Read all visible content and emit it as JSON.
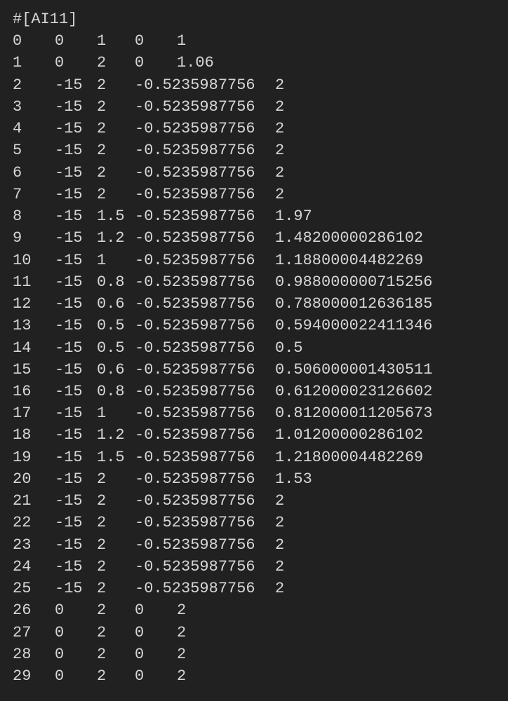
{
  "header": "#[AI11]",
  "rows": [
    {
      "c1": "0",
      "c2": "0",
      "c3": "1",
      "c4": "0",
      "c5": "1",
      "short4": true
    },
    {
      "c1": "1",
      "c2": "0",
      "c3": "2",
      "c4": "0",
      "c5": "1.06",
      "short4": true
    },
    {
      "c1": "2",
      "c2": "-15",
      "c3": "2",
      "c4": "-0.5235987756",
      "c5": "2",
      "short4": false
    },
    {
      "c1": "3",
      "c2": "-15",
      "c3": "2",
      "c4": "-0.5235987756",
      "c5": "2",
      "short4": false
    },
    {
      "c1": "4",
      "c2": "-15",
      "c3": "2",
      "c4": "-0.5235987756",
      "c5": "2",
      "short4": false
    },
    {
      "c1": "5",
      "c2": "-15",
      "c3": "2",
      "c4": "-0.5235987756",
      "c5": "2",
      "short4": false
    },
    {
      "c1": "6",
      "c2": "-15",
      "c3": "2",
      "c4": "-0.5235987756",
      "c5": "2",
      "short4": false
    },
    {
      "c1": "7",
      "c2": "-15",
      "c3": "2",
      "c4": "-0.5235987756",
      "c5": "2",
      "short4": false
    },
    {
      "c1": "8",
      "c2": "-15",
      "c3": "1.5",
      "c4": "-0.5235987756",
      "c5": "1.97",
      "short4": false
    },
    {
      "c1": "9",
      "c2": "-15",
      "c3": "1.2",
      "c4": "-0.5235987756",
      "c5": "1.48200000286102",
      "short4": false
    },
    {
      "c1": "10",
      "c2": "-15",
      "c3": "1",
      "c4": "-0.5235987756",
      "c5": "1.18800004482269",
      "short4": false
    },
    {
      "c1": "11",
      "c2": "-15",
      "c3": "0.8",
      "c4": "-0.5235987756",
      "c5": "0.988000000715256",
      "short4": false
    },
    {
      "c1": "12",
      "c2": "-15",
      "c3": "0.6",
      "c4": "-0.5235987756",
      "c5": "0.788000012636185",
      "short4": false
    },
    {
      "c1": "13",
      "c2": "-15",
      "c3": "0.5",
      "c4": "-0.5235987756",
      "c5": "0.594000022411346",
      "short4": false
    },
    {
      "c1": "14",
      "c2": "-15",
      "c3": "0.5",
      "c4": "-0.5235987756",
      "c5": "0.5",
      "short4": false
    },
    {
      "c1": "15",
      "c2": "-15",
      "c3": "0.6",
      "c4": "-0.5235987756",
      "c5": "0.506000001430511",
      "short4": false
    },
    {
      "c1": "16",
      "c2": "-15",
      "c3": "0.8",
      "c4": "-0.5235987756",
      "c5": "0.612000023126602",
      "short4": false
    },
    {
      "c1": "17",
      "c2": "-15",
      "c3": "1",
      "c4": "-0.5235987756",
      "c5": "0.812000011205673",
      "short4": false
    },
    {
      "c1": "18",
      "c2": "-15",
      "c3": "1.2",
      "c4": "-0.5235987756",
      "c5": "1.01200000286102",
      "short4": false
    },
    {
      "c1": "19",
      "c2": "-15",
      "c3": "1.5",
      "c4": "-0.5235987756",
      "c5": "1.21800004482269",
      "short4": false
    },
    {
      "c1": "20",
      "c2": "-15",
      "c3": "2",
      "c4": "-0.5235987756",
      "c5": "1.53",
      "short4": false
    },
    {
      "c1": "21",
      "c2": "-15",
      "c3": "2",
      "c4": "-0.5235987756",
      "c5": "2",
      "short4": false
    },
    {
      "c1": "22",
      "c2": "-15",
      "c3": "2",
      "c4": "-0.5235987756",
      "c5": "2",
      "short4": false
    },
    {
      "c1": "23",
      "c2": "-15",
      "c3": "2",
      "c4": "-0.5235987756",
      "c5": "2",
      "short4": false
    },
    {
      "c1": "24",
      "c2": "-15",
      "c3": "2",
      "c4": "-0.5235987756",
      "c5": "2",
      "short4": false
    },
    {
      "c1": "25",
      "c2": "-15",
      "c3": "2",
      "c4": "-0.5235987756",
      "c5": "2",
      "short4": false
    },
    {
      "c1": "26",
      "c2": "0",
      "c3": "2",
      "c4": "0",
      "c5": "2",
      "short4": true
    },
    {
      "c1": "27",
      "c2": "0",
      "c3": "2",
      "c4": "0",
      "c5": "2",
      "short4": true
    },
    {
      "c1": "28",
      "c2": "0",
      "c3": "2",
      "c4": "0",
      "c5": "2",
      "short4": true
    },
    {
      "c1": "29",
      "c2": "0",
      "c3": "2",
      "c4": "0",
      "c5": "2",
      "short4": true
    }
  ]
}
